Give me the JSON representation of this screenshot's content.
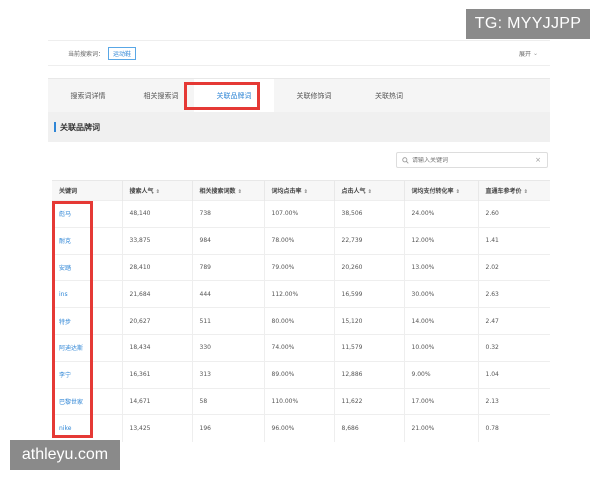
{
  "watermarks": {
    "top": "TG: MYYJJPP",
    "bottom": "athleyu.com"
  },
  "current": {
    "label": "当前搜索词：",
    "tag": "运动鞋",
    "expand": "展开"
  },
  "tabs": [
    {
      "label": "搜索词详情",
      "active": false
    },
    {
      "label": "相关搜索词",
      "active": false
    },
    {
      "label": "关联品牌词",
      "active": true
    },
    {
      "label": "关联修饰词",
      "active": false
    },
    {
      "label": "关联热词",
      "active": false
    }
  ],
  "section": {
    "title": "关联品牌词"
  },
  "search": {
    "placeholder": "请输入关键词",
    "clear": "×"
  },
  "table": {
    "headers": [
      "关键词",
      "搜索人气",
      "相关搜索词数",
      "词均点击率",
      "点击人气",
      "词均支付转化率",
      "直通车参考价"
    ],
    "sortable": [
      false,
      true,
      true,
      true,
      true,
      true,
      true
    ],
    "rows": [
      [
        "彪马",
        "48,140",
        "738",
        "107.00%",
        "38,506",
        "24.00%",
        "2.60"
      ],
      [
        "耐克",
        "33,875",
        "984",
        "78.00%",
        "22,739",
        "12.00%",
        "1.41"
      ],
      [
        "安踏",
        "28,410",
        "789",
        "79.00%",
        "20,260",
        "13.00%",
        "2.02"
      ],
      [
        "ins",
        "21,684",
        "444",
        "112.00%",
        "16,599",
        "30.00%",
        "2.63"
      ],
      [
        "特步",
        "20,627",
        "511",
        "80.00%",
        "15,120",
        "14.00%",
        "2.47"
      ],
      [
        "阿迪达斯",
        "18,434",
        "330",
        "74.00%",
        "11,579",
        "10.00%",
        "0.32"
      ],
      [
        "李宁",
        "16,361",
        "313",
        "89.00%",
        "12,886",
        "9.00%",
        "1.04"
      ],
      [
        "巴黎世家",
        "14,671",
        "58",
        "110.00%",
        "11,622",
        "17.00%",
        "2.13"
      ],
      [
        "nike",
        "13,425",
        "196",
        "96.00%",
        "8,686",
        "21.00%",
        "0.78"
      ]
    ]
  },
  "colors": {
    "accent": "#2f86d6",
    "highlight": "#e53935"
  }
}
